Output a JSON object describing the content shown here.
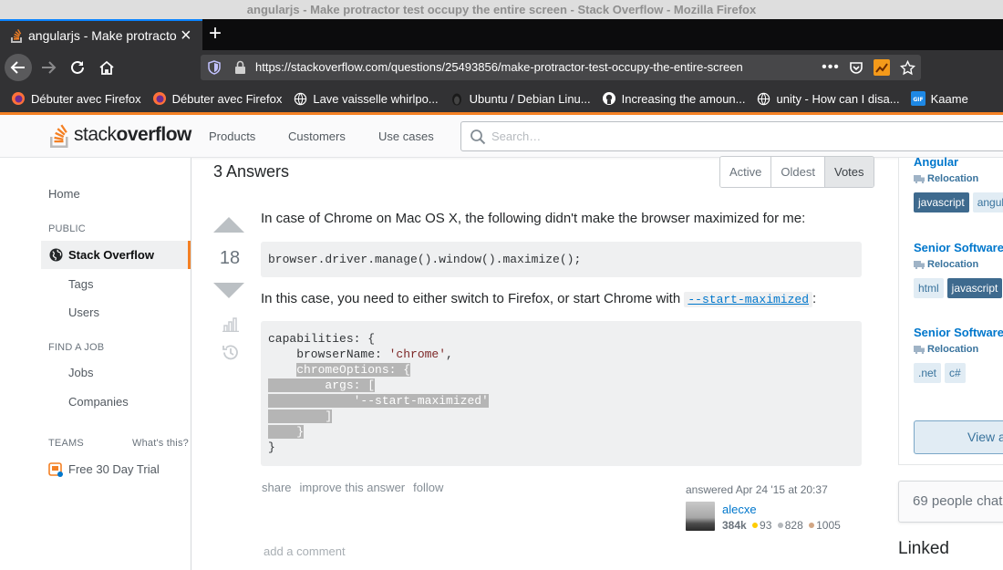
{
  "window": {
    "title": "angularjs - Make protractor test occupy the entire screen - Stack Overflow - Mozilla Firefox"
  },
  "tab": {
    "title": "angularjs - Make protractor"
  },
  "urlbar": {
    "url": "https://stackoverflow.com/questions/25493856/make-protractor-test-occupy-the-entire-screen"
  },
  "bookmarks": [
    {
      "label": "Débuter avec Firefox",
      "icon": "firefox-icon"
    },
    {
      "label": "Débuter avec Firefox",
      "icon": "firefox-icon"
    },
    {
      "label": "Lave vaisselle whirlpo...",
      "icon": "globe-icon"
    },
    {
      "label": "Ubuntu / Debian Linu...",
      "icon": "linux-icon"
    },
    {
      "label": "Increasing the amoun...",
      "icon": "github-icon"
    },
    {
      "label": "unity - How can I disa...",
      "icon": "globe-icon"
    },
    {
      "label": "Kaame",
      "icon": "gif-icon"
    }
  ],
  "so_header": {
    "logo_light": "stack",
    "logo_bold": "overflow",
    "nav": [
      "Products",
      "Customers",
      "Use cases"
    ],
    "search_placeholder": "Search…"
  },
  "leftnav": {
    "home": "Home",
    "public_head": "PUBLIC",
    "stackoverflow": "Stack Overflow",
    "tags": "Tags",
    "users": "Users",
    "find_job_head": "FIND A JOB",
    "jobs": "Jobs",
    "companies": "Companies",
    "teams_head": "TEAMS",
    "whats_this": "What's this?",
    "free_trial": "Free 30 Day Trial"
  },
  "answers": {
    "title": "3 Answers",
    "sort": [
      "Active",
      "Oldest",
      "Votes"
    ],
    "sort_active": "Votes"
  },
  "answer": {
    "votes": "18",
    "p1": "In case of Chrome on Mac OS X, the following didn't make the browser maximized for me:",
    "code1": "browser.driver.manage().window().maximize();",
    "p2_before": "In this case, you need to either switch to Firefox, or start Chrome with ",
    "p2_code": "--start-maximized",
    "p2_after": ":",
    "code2": {
      "l1": "capabilities: {",
      "l2a": "    browserName: ",
      "l2b": "'chrome'",
      "l2c": ",",
      "l3a": "    ",
      "l3b": "chromeOptions: {",
      "l4a": "        args: [",
      "l5a": "            ",
      "l5b": "'--start-maximized'",
      "l6a": "        ]",
      "l7a": "    }",
      "l8": "}"
    },
    "menu": [
      "share",
      "improve this answer",
      "follow"
    ],
    "add_comment": "add a comment",
    "answered": "answered Apr 24 '15 at 20:37",
    "user_name": "alecxe",
    "reputation": "384k",
    "gold": "93",
    "silver": "828",
    "bronze": "1005"
  },
  "jobs": [
    {
      "title": "Angular",
      "reloc": "Relocation",
      "tags": [
        "javascript",
        "angul"
      ]
    },
    {
      "title": "Senior Software",
      "reloc": "Relocation",
      "tags": [
        "html",
        "javascript"
      ]
    },
    {
      "title": "Senior Software",
      "reloc": "Relocation",
      "tags": [
        ".net",
        "c#"
      ]
    }
  ],
  "view_all": "View a",
  "chat": "69 people chat",
  "linked": "Linked",
  "colors": {
    "accent": "#f48024",
    "link": "#0077cc",
    "gold": "#ffcc01",
    "silver": "#b4b8bc",
    "bronze": "#d1a684"
  }
}
